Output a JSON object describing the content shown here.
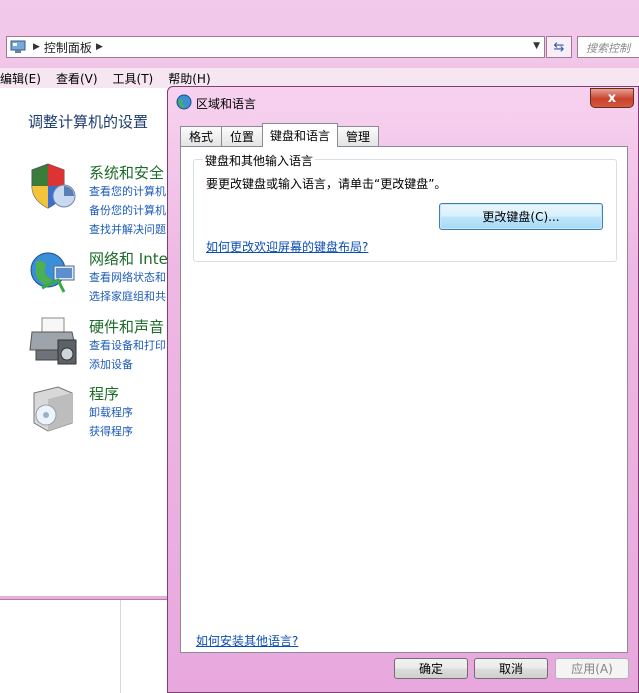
{
  "address": {
    "crumb": "控制面板",
    "search_placeholder": "搜索控制"
  },
  "menu": [
    "编辑(E)",
    "查看(V)",
    "工具(T)",
    "帮助(H)"
  ],
  "control_panel": {
    "heading": "调整计算机的设置",
    "categories": [
      {
        "title": "系统和安全",
        "links": [
          "查看您的计算机",
          "备份您的计算机",
          "查找并解决问题"
        ]
      },
      {
        "title": "网络和 Inte",
        "links": [
          "查看网络状态和",
          "选择家庭组和共"
        ]
      },
      {
        "title": "硬件和声音",
        "links": [
          "查看设备和打印",
          "添加设备"
        ]
      },
      {
        "title": "程序",
        "links": [
          "卸载程序",
          "获得程序"
        ]
      }
    ]
  },
  "dialog": {
    "title": "区域和语言",
    "close_label": "x",
    "tabs": [
      "格式",
      "位置",
      "键盘和语言",
      "管理"
    ],
    "active_tab": 2,
    "group": {
      "legend": "键盘和其他输入语言",
      "description": "要更改键盘或输入语言，请单击“更改键盘”。",
      "change_button": "更改键盘(C)...",
      "welcome_link": "如何更改欢迎屏幕的键盘布局?"
    },
    "install_link": "如何安装其他语言?",
    "buttons": {
      "ok": "确定",
      "cancel": "取消",
      "apply": "应用(A)"
    }
  }
}
